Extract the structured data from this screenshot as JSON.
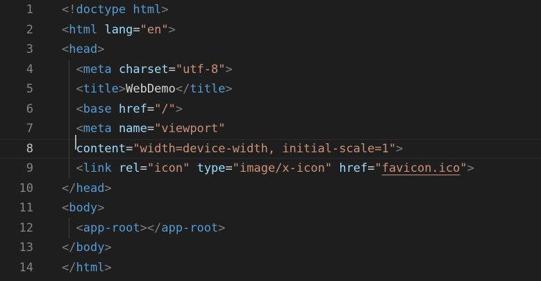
{
  "editor": {
    "language": "html",
    "current_line": 8,
    "lines": [
      {
        "num": "1",
        "tokens": [
          [
            "p",
            "<!"
          ],
          [
            "t",
            "doctype"
          ],
          [
            "o",
            " "
          ],
          [
            "t",
            "html"
          ],
          [
            "p",
            ">"
          ]
        ]
      },
      {
        "num": "2",
        "tokens": [
          [
            "p",
            "<"
          ],
          [
            "t",
            "html"
          ],
          [
            "o",
            " "
          ],
          [
            "a",
            "lang"
          ],
          [
            "o",
            "="
          ],
          [
            "s",
            "\"en\""
          ],
          [
            "p",
            ">"
          ]
        ]
      },
      {
        "num": "3",
        "tokens": [
          [
            "p",
            "<"
          ],
          [
            "t",
            "head"
          ],
          [
            "p",
            ">"
          ]
        ]
      },
      {
        "num": "4",
        "guide": true,
        "tokens": [
          [
            "o",
            "  "
          ],
          [
            "p",
            "<"
          ],
          [
            "t",
            "meta"
          ],
          [
            "o",
            " "
          ],
          [
            "a",
            "charset"
          ],
          [
            "o",
            "="
          ],
          [
            "s",
            "\"utf-8\""
          ],
          [
            "p",
            ">"
          ]
        ]
      },
      {
        "num": "5",
        "guide": true,
        "tokens": [
          [
            "o",
            "  "
          ],
          [
            "p",
            "<"
          ],
          [
            "t",
            "title"
          ],
          [
            "p",
            ">"
          ],
          [
            "o",
            "WebDemo"
          ],
          [
            "p",
            "</"
          ],
          [
            "t",
            "title"
          ],
          [
            "p",
            ">"
          ]
        ]
      },
      {
        "num": "6",
        "guide": true,
        "tokens": [
          [
            "o",
            "  "
          ],
          [
            "p",
            "<"
          ],
          [
            "t",
            "base"
          ],
          [
            "o",
            " "
          ],
          [
            "a",
            "href"
          ],
          [
            "o",
            "="
          ],
          [
            "s",
            "\"/\""
          ],
          [
            "p",
            ">"
          ]
        ]
      },
      {
        "num": "7",
        "guide": true,
        "tokens": [
          [
            "o",
            "  "
          ],
          [
            "p",
            "<"
          ],
          [
            "t",
            "meta"
          ],
          [
            "o",
            " "
          ],
          [
            "a",
            "name"
          ],
          [
            "o",
            "="
          ],
          [
            "s",
            "\"viewport\""
          ]
        ]
      },
      {
        "num": "8",
        "guide": true,
        "cursor": true,
        "tokens": [
          [
            "o",
            "  "
          ],
          [
            "a",
            "content"
          ],
          [
            "o",
            "="
          ],
          [
            "s",
            "\"width=device-width, initial-scale=1\""
          ],
          [
            "p",
            ">"
          ]
        ]
      },
      {
        "num": "9",
        "guide": true,
        "tokens": [
          [
            "o",
            "  "
          ],
          [
            "p",
            "<"
          ],
          [
            "t",
            "link"
          ],
          [
            "o",
            " "
          ],
          [
            "a",
            "rel"
          ],
          [
            "o",
            "="
          ],
          [
            "s",
            "\"icon\""
          ],
          [
            "o",
            " "
          ],
          [
            "a",
            "type"
          ],
          [
            "o",
            "="
          ],
          [
            "s",
            "\"image/x-icon\""
          ],
          [
            "o",
            " "
          ],
          [
            "a",
            "href"
          ],
          [
            "o",
            "="
          ],
          [
            "s",
            "\""
          ],
          [
            "su",
            "favicon.ico"
          ],
          [
            "s",
            "\""
          ],
          [
            "p",
            ">"
          ]
        ]
      },
      {
        "num": "10",
        "tokens": [
          [
            "p",
            "</"
          ],
          [
            "t",
            "head"
          ],
          [
            "p",
            ">"
          ]
        ]
      },
      {
        "num": "11",
        "tokens": [
          [
            "p",
            "<"
          ],
          [
            "t",
            "body"
          ],
          [
            "p",
            ">"
          ]
        ]
      },
      {
        "num": "12",
        "guide": true,
        "tokens": [
          [
            "o",
            "  "
          ],
          [
            "p",
            "<"
          ],
          [
            "t",
            "app-root"
          ],
          [
            "p",
            "></"
          ],
          [
            "t",
            "app-root"
          ],
          [
            "p",
            ">"
          ]
        ]
      },
      {
        "num": "13",
        "tokens": [
          [
            "p",
            "</"
          ],
          [
            "t",
            "body"
          ],
          [
            "p",
            ">"
          ]
        ]
      },
      {
        "num": "14",
        "tokens": [
          [
            "p",
            "</"
          ],
          [
            "t",
            "html"
          ],
          [
            "p",
            ">"
          ]
        ]
      }
    ]
  },
  "colors": {
    "background": "#1e1e1e",
    "line_number": "#858585",
    "punctuation": "#808080",
    "tag": "#569cd6",
    "attribute": "#9cdcfe",
    "string": "#ce9178",
    "text": "#d4d4d4"
  }
}
